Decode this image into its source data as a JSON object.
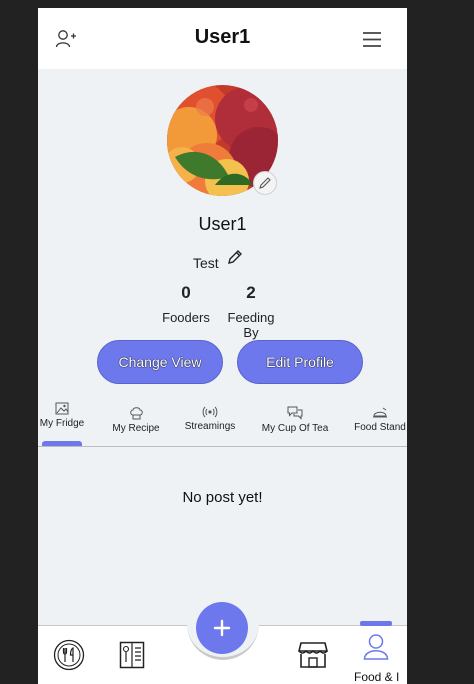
{
  "header": {
    "title": "User1",
    "add_friend_icon": "person-plus-icon",
    "menu_icon": "hamburger-menu-icon"
  },
  "profile": {
    "avatar": "peaches-photo",
    "username": "User1",
    "bio": "Test",
    "stats": [
      {
        "value": "0",
        "label": "Fooders"
      },
      {
        "value": "2",
        "label": "Feeding By"
      }
    ]
  },
  "actions": {
    "change_view": "Change View",
    "edit_profile": "Edit Profile"
  },
  "tabs": [
    {
      "label": "My Fridge",
      "icon": "image-icon",
      "active": true
    },
    {
      "label": "My Recipe",
      "icon": "chef-hat-icon",
      "active": false
    },
    {
      "label": "Streamings",
      "icon": "broadcast-icon",
      "active": false
    },
    {
      "label": "My Cup Of Tea",
      "icon": "chat-bubbles-icon",
      "active": false
    },
    {
      "label": "Food Stand",
      "icon": "serving-dish-icon",
      "active": false
    }
  ],
  "empty_message": "No post yet!",
  "bottom_nav": {
    "items": [
      {
        "icon": "fork-knife-icon"
      },
      {
        "icon": "menu-book-icon"
      },
      {
        "icon": "storefront-icon"
      },
      {
        "icon": "person-icon",
        "label": "Food & I",
        "active": true
      }
    ],
    "fab_icon": "plus-icon"
  },
  "colors": {
    "accent": "#6d78ec",
    "background": "#eff2f5",
    "outer": "#222222"
  }
}
